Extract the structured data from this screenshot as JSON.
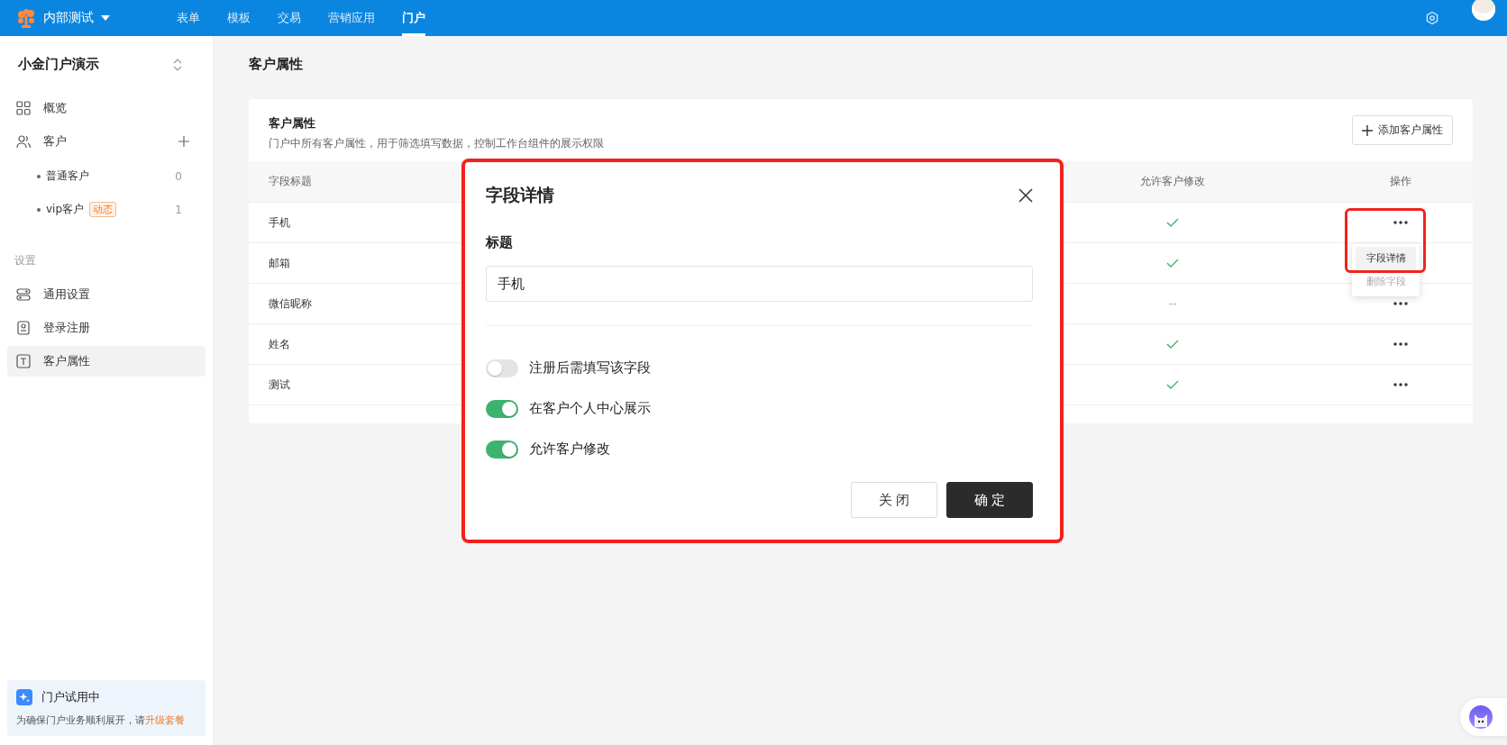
{
  "topbar": {
    "brand": "内部测试",
    "nav": [
      {
        "label": "表单",
        "selected": false
      },
      {
        "label": "模板",
        "selected": false
      },
      {
        "label": "交易",
        "selected": false
      },
      {
        "label": "营销应用",
        "selected": false
      },
      {
        "label": "门户",
        "selected": true
      }
    ]
  },
  "sidebar": {
    "portal_name": "小金门户演示",
    "nav": [
      {
        "label": "概览",
        "selected": false
      },
      {
        "label": "客户",
        "selected": false,
        "children": [
          {
            "label": "普通客户",
            "count": "0"
          },
          {
            "label": "vip客户",
            "badge": "动态",
            "count": "1"
          }
        ]
      }
    ],
    "section": "设置",
    "settings": [
      {
        "label": "通用设置",
        "selected": false
      },
      {
        "label": "登录注册",
        "selected": false
      },
      {
        "label": "客户属性",
        "selected": true
      }
    ],
    "trial": {
      "title": "门户试用中",
      "text": "为确保门户业务顺利展开，请",
      "link": "升级套餐"
    }
  },
  "page_title": "客户属性",
  "card": {
    "title": "客户属性",
    "description": "门户中所有客户属性，用于筛选填写数据，控制工作台组件的展示权限",
    "add_button": "添加客户属性"
  },
  "table": {
    "columns": [
      "字段标题",
      "允许客户修改",
      "操作"
    ],
    "rows": [
      {
        "title": "手机",
        "allow_edit": true,
        "show_more": true
      },
      {
        "title": "邮箱",
        "allow_edit": true,
        "show_more": false
      },
      {
        "title": "微信昵称",
        "allow_edit_text": "--",
        "show_more": true
      },
      {
        "title": "姓名",
        "allow_edit": true,
        "show_more": true
      },
      {
        "title": "测试",
        "allow_edit": true,
        "show_more": true
      }
    ]
  },
  "row_menu": {
    "items": [
      {
        "label": "字段详情",
        "selected": true,
        "disabled": false
      },
      {
        "label": "删除字段",
        "selected": false,
        "disabled": true
      }
    ]
  },
  "dialog": {
    "title": "字段详情",
    "field_label": "标题",
    "field_value": "手机",
    "toggles": [
      {
        "label": "注册后需填写该字段",
        "on": false
      },
      {
        "label": "在客户个人中心展示",
        "on": true
      },
      {
        "label": "允许客户修改",
        "on": true
      }
    ],
    "buttons": [
      {
        "label": "关 闭",
        "kind": "secondary"
      },
      {
        "label": "确 定",
        "kind": "primary"
      }
    ]
  }
}
